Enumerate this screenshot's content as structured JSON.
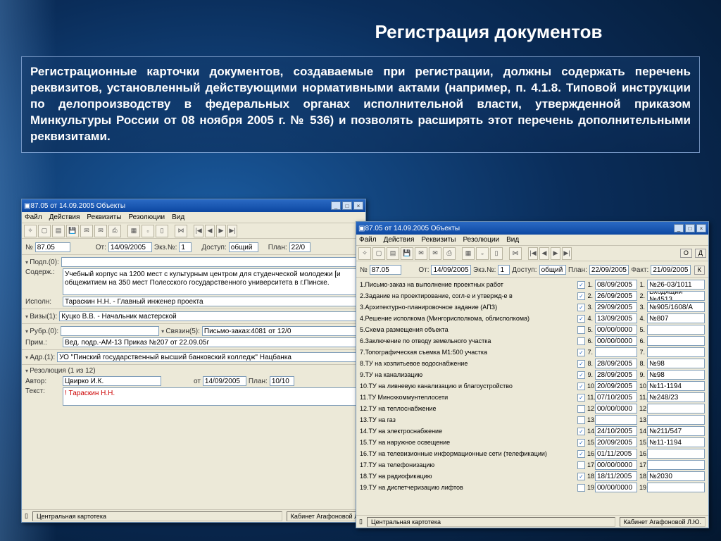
{
  "slide": {
    "title": "Регистрация документов",
    "description": "Регистрационные карточки документов, создаваемые при регистрации, должны содержать перечень реквизитов, установленный действующими нормативными актами (например, п. 4.1.8. Типовой инструкции по делопроизводству в федеральных органах исполнительной власти, утвержденной приказом Минкультуры России от 08 ноября 2005 г. № 536) и позволять расширять этот перечень дополнительными реквизитами."
  },
  "menu": {
    "file": "Файл",
    "actions": "Действия",
    "requisites": "Реквизиты",
    "resolutions": "Резолюции",
    "view": "Вид"
  },
  "win1": {
    "title": "87.05 от 14.09.2005 Объекты",
    "labels": {
      "num": "№",
      "ot": "От:",
      "ekz": "Экз.№:",
      "dostup": "Доступ:",
      "plan": "План:",
      "podp": "Подп.(0):",
      "soderzh": "Содерж.:",
      "ispoln": "Исполн:",
      "vizy": "Визы(1):",
      "rubr": "Рубр.(0):",
      "svyazin": "Связин(5):",
      "prim": "Прим.:",
      "adr": "Адр.(1):",
      "rezol": "Резолюция (1 из 12)",
      "avtor": "Автор:",
      "tekst": "Текст:",
      "ot2": "от",
      "plan2": "План:"
    },
    "num": "87.05",
    "date": "14/09/2005",
    "ekz": "1",
    "dostup": "общий",
    "plan": "22/0",
    "soderzh": "Учебный корпус на 1200 мест с культурным центром для студенческой молодежи [и общежитием на 350 мест  Полесского государственного университета в г.Пинске.",
    "ispoln": "Тараскин Н.Н. - Главный инженер проекта",
    "vizy": "Куцко В.В. - Начальник мастерской",
    "svyazin": "Письмо-заказ:4081 от 12/0",
    "prim": "Вед. подр.-АМ-13 Приказ №207 от 22.09.05г",
    "adr": "УО \"Пинский государственный высший банковский колледж\" Нацбанка",
    "avtor": "Цвирко И.К.",
    "resdate": "14/09/2005",
    "resplan": "10/10",
    "tekst_red": "! Тараскин Н.Н.",
    "status_left": "Центральная картотека",
    "status_right": "Кабинет Агафоновой Л"
  },
  "win2": {
    "title": "87.05 от 14.09.2005 Объекты",
    "labels": {
      "num": "№",
      "ot": "От:",
      "ekz": "Экз.№:",
      "dostup": "Доступ:",
      "plan": "План:",
      "fakt": "Факт:"
    },
    "num": "87.05",
    "date": "14/09/2005",
    "ekz": "1",
    "dostup": "общий",
    "plan": "22/09/2005",
    "fakt": "21/09/2005",
    "rows": [
      {
        "n": "1",
        "t": "Письмо-заказ на выполнение проектных работ",
        "c": true,
        "d": "08/09/2005",
        "r": "№26-03/1011"
      },
      {
        "n": "2",
        "t": "Задание на проектирование, согл-е и утвержд-е в",
        "c": true,
        "d": "26/09/2005",
        "r": "Входящий №4513"
      },
      {
        "n": "3",
        "t": "Архитектурно-планировочное задание (АПЗ)",
        "c": true,
        "d": "29/09/2005",
        "r": "№905/1608/А"
      },
      {
        "n": "4",
        "t": "Решение исполкома (Мингорисполкома, облисполкома)",
        "c": true,
        "d": "13/09/2005",
        "r": "№807"
      },
      {
        "n": "5",
        "t": "Схема размещения объекта",
        "c": false,
        "d": "00/00/0000",
        "r": ""
      },
      {
        "n": "6",
        "t": "Заключение по отводу земельного участка",
        "c": false,
        "d": "00/00/0000",
        "r": ""
      },
      {
        "n": "7",
        "t": "Топографическая съемка М1:500 участка",
        "c": true,
        "d": "",
        "r": ""
      },
      {
        "n": "8",
        "t": "ТУ на хозпитьевое водоснабжение",
        "c": true,
        "d": "28/09/2005",
        "r": "№98"
      },
      {
        "n": "9",
        "t": "ТУ на канализацию",
        "c": true,
        "d": "28/09/2005",
        "r": "№98"
      },
      {
        "n": "10",
        "t": "ТУ на ливневую канализацию и благоустройство",
        "c": true,
        "d": "20/09/2005",
        "r": "№11-1194"
      },
      {
        "n": "11",
        "t": "ТУ Минсккоммунтеплосети",
        "c": true,
        "d": "07/10/2005",
        "r": "№248/23"
      },
      {
        "n": "12",
        "t": "ТУ на теплоснабжение",
        "c": false,
        "d": "00/00/0000",
        "r": ""
      },
      {
        "n": "13",
        "t": "ТУ на газ",
        "c": false,
        "d": "",
        "r": ""
      },
      {
        "n": "14",
        "t": "ТУ на электроснабжение",
        "c": true,
        "d": "24/10/2005",
        "r": "№211/547"
      },
      {
        "n": "15",
        "t": "ТУ на наружное освещение",
        "c": true,
        "d": "20/09/2005",
        "r": "№11-1194"
      },
      {
        "n": "16",
        "t": "ТУ на телевизионные информационные сети (телефикации)",
        "c": true,
        "d": "01/11/2005",
        "r": ""
      },
      {
        "n": "17",
        "t": "ТУ на телефонизацию",
        "c": false,
        "d": "00/00/0000",
        "r": ""
      },
      {
        "n": "18",
        "t": "ТУ на радиофикацию",
        "c": true,
        "d": "18/11/2005",
        "r": "№2030"
      },
      {
        "n": "19",
        "t": "ТУ на диспетчеризацию лифтов",
        "c": false,
        "d": "00/00/0000",
        "r": ""
      }
    ],
    "btns": {
      "o": "О",
      "d": "Д",
      "k": "К"
    },
    "status_left": "Центральная картотека",
    "status_right": "Кабинет Агафоновой Л.Ю."
  }
}
